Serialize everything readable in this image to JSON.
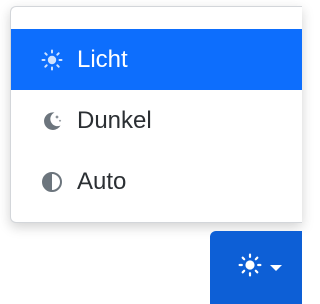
{
  "theme_menu": {
    "items": [
      {
        "label": "Licht",
        "icon": "sun-icon",
        "active": true
      },
      {
        "label": "Dunkel",
        "icon": "moon-stars-icon",
        "active": false
      },
      {
        "label": "Auto",
        "icon": "circle-half-icon",
        "active": false
      }
    ]
  },
  "toggle_button": {
    "icon": "sun-icon",
    "caret": "chevron-down-icon"
  },
  "colors": {
    "accent": "#0d6efd",
    "button": "#0d5fd6",
    "text": "#2b2f33",
    "icon_gray": "#6c757d"
  }
}
